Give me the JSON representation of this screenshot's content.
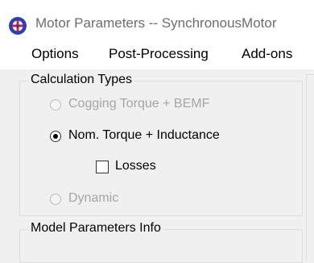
{
  "window": {
    "title": "Motor Parameters -- SynchronousMotor",
    "icon": "app-logo-icon"
  },
  "menu": {
    "items": [
      {
        "label": "Options"
      },
      {
        "label": "Post-Processing"
      },
      {
        "label": "Add-ons"
      }
    ]
  },
  "calc_types": {
    "label": "Calculation Types",
    "cogging": {
      "label": "Cogging Torque + BEMF",
      "enabled": false,
      "selected": false
    },
    "nominal": {
      "label": "Nom. Torque + Inductance",
      "enabled": true,
      "selected": true
    },
    "losses": {
      "label": "Losses",
      "checked": false
    },
    "dynamic": {
      "label": "Dynamic",
      "enabled": false,
      "selected": false
    }
  },
  "model_info": {
    "label": "Model Parameters Info"
  },
  "colors": {
    "disabled_text": "#a5a5a5",
    "title_text": "#6d6d6d",
    "icon_blue": "#2e3fb0",
    "icon_red": "#e02020"
  }
}
